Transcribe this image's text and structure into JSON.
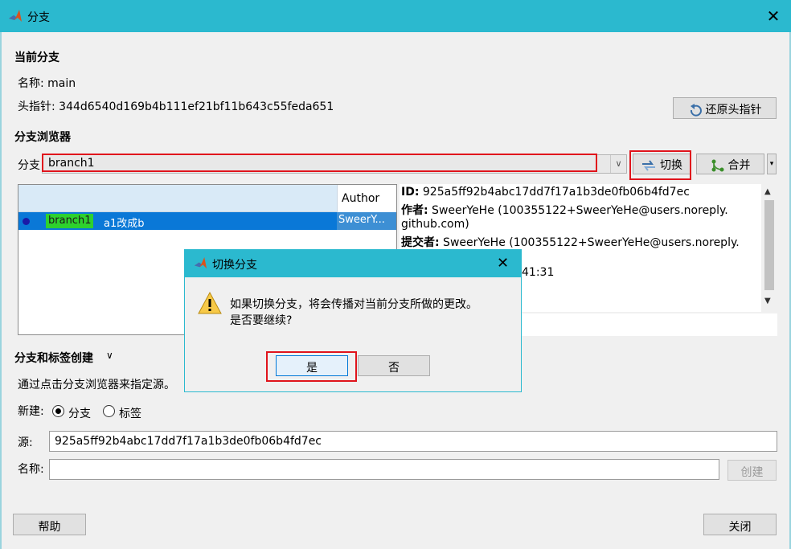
{
  "window": {
    "title": "分支",
    "close": "✕"
  },
  "current_branch": {
    "section_title": "当前分支",
    "name_line": "名称: main",
    "head_line": "头指针: 344d6540d169b4b111ef21bf11b643c55feda651",
    "restore_head_button": "还原头指针"
  },
  "browser": {
    "section_title": "分支浏览器",
    "branch_label": "分支",
    "branch_value": "branch1",
    "switch_button": "切换",
    "merge_button": "合并",
    "table": {
      "author_header": "Author",
      "rows": [
        {
          "tag": "branch1",
          "message": "a1改成b",
          "author": "SweerY..."
        }
      ]
    },
    "details": {
      "id_label": "ID:",
      "id_value": " 925a5ff92b4abc17dd7f17a1b3de0fb06b4fd7ec",
      "author_label": "作者:",
      "author_value": " SweerYeHe (100355122+SweerYeHe@users.noreply.",
      "author_cont": "github.com)",
      "committer_label": "提交者:",
      "committer_value": " SweerYeHe (100355122+SweerYeHe@users.noreply.",
      "time_fragment": "41:31"
    }
  },
  "create": {
    "section_title": "分支和标签创建",
    "hint": "通过点击分支浏览器来指定源。",
    "new_label": "新建:",
    "option_branch": "分支",
    "option_tag": "标签",
    "source_label": "源:",
    "source_value": "925a5ff92b4abc17dd7f17a1b3de0fb06b4fd7ec",
    "name_label": "名称:",
    "name_value": "",
    "create_button": "创建"
  },
  "footer": {
    "help_button": "帮助",
    "close_button": "关闭"
  },
  "dialog": {
    "title": "切换分支",
    "close": "✕",
    "message_line1": "如果切换分支，将会传播对当前分支所做的更改。",
    "message_line2": "是否要继续?",
    "yes_button": "是",
    "no_button": "否"
  },
  "colors": {
    "titlebar": "#2bb9cf",
    "selection": "#0a78d7",
    "branch_tag": "#2ed12e",
    "highlight_box": "#e0141c"
  }
}
